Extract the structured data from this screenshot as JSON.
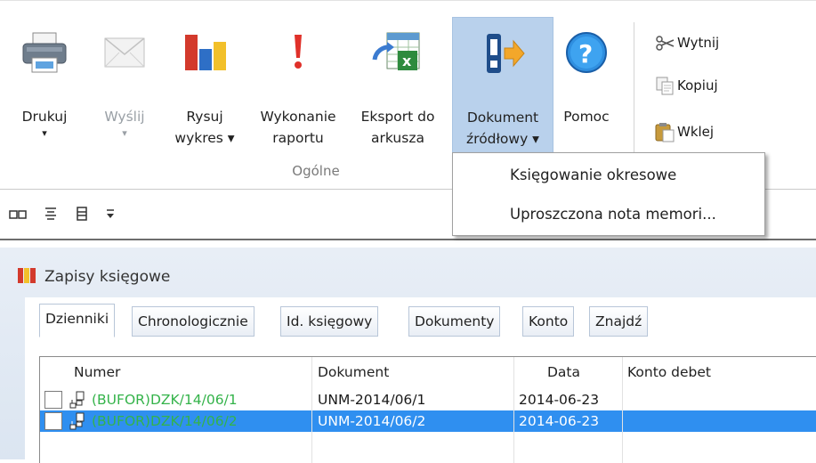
{
  "ribbon": {
    "buttons": [
      {
        "id": "drukuj",
        "label_line1": "Drukuj",
        "label_line2": "▾",
        "icon": "printer-icon"
      },
      {
        "id": "wyslij",
        "label_line1": "Wyślij",
        "label_line2": "▾",
        "icon": "envelope-icon",
        "disabled": true
      },
      {
        "id": "rysuj",
        "label_line1": "Rysuj",
        "label_line2": "wykres ▾",
        "icon": "bar-chart-icon"
      },
      {
        "id": "wykonanie",
        "label_line1": "Wykonanie",
        "label_line2": "raportu",
        "icon": "exclamation-icon"
      },
      {
        "id": "eksport",
        "label_line1": "Eksport do",
        "label_line2": "arkusza",
        "icon": "spreadsheet-export-icon"
      },
      {
        "id": "dokument",
        "label_line1": "Dokument",
        "label_line2": "źródłowy ▾",
        "icon": "source-document-icon",
        "active": true
      },
      {
        "id": "pomoc",
        "label_line1": "Pomoc",
        "label_line2": "",
        "icon": "help-icon"
      }
    ],
    "group_label": "Ogólne",
    "small_buttons": [
      {
        "id": "wytnij",
        "label": "Wytnij",
        "icon": "scissors-icon"
      },
      {
        "id": "kopiuj",
        "label": "Kopiuj",
        "icon": "copy-icon"
      },
      {
        "id": "wklej",
        "label": "Wklej",
        "icon": "paste-icon"
      }
    ]
  },
  "dropdown": {
    "items": [
      "Księgowanie okresowe",
      "Uproszczona nota memori..."
    ]
  },
  "panel": {
    "title": "Zapisy księgowe",
    "tabs": [
      "Dzienniki",
      "Chronologicznie",
      "Id. księgowy",
      "Dokumenty",
      "Konto",
      "Znajdź"
    ],
    "active_tab": "Dzienniki"
  },
  "grid": {
    "columns": [
      "Numer",
      "Dokument",
      "Data",
      "Konto debet"
    ],
    "rows": [
      {
        "numer": "(BUFOR)DZK/14/06/1",
        "dokument": "UNM-2014/06/1",
        "data": "2014-06-23",
        "konto_debet": "",
        "selected": false
      },
      {
        "numer": "(BUFOR)DZK/14/06/2",
        "dokument": "UNM-2014/06/2",
        "data": "2014-06-23",
        "konto_debet": "",
        "selected": true
      }
    ]
  },
  "colors": {
    "accent_selected": "#2f8ff0",
    "active_button": "#b9d1ec",
    "bufor_green": "#34b34a"
  }
}
